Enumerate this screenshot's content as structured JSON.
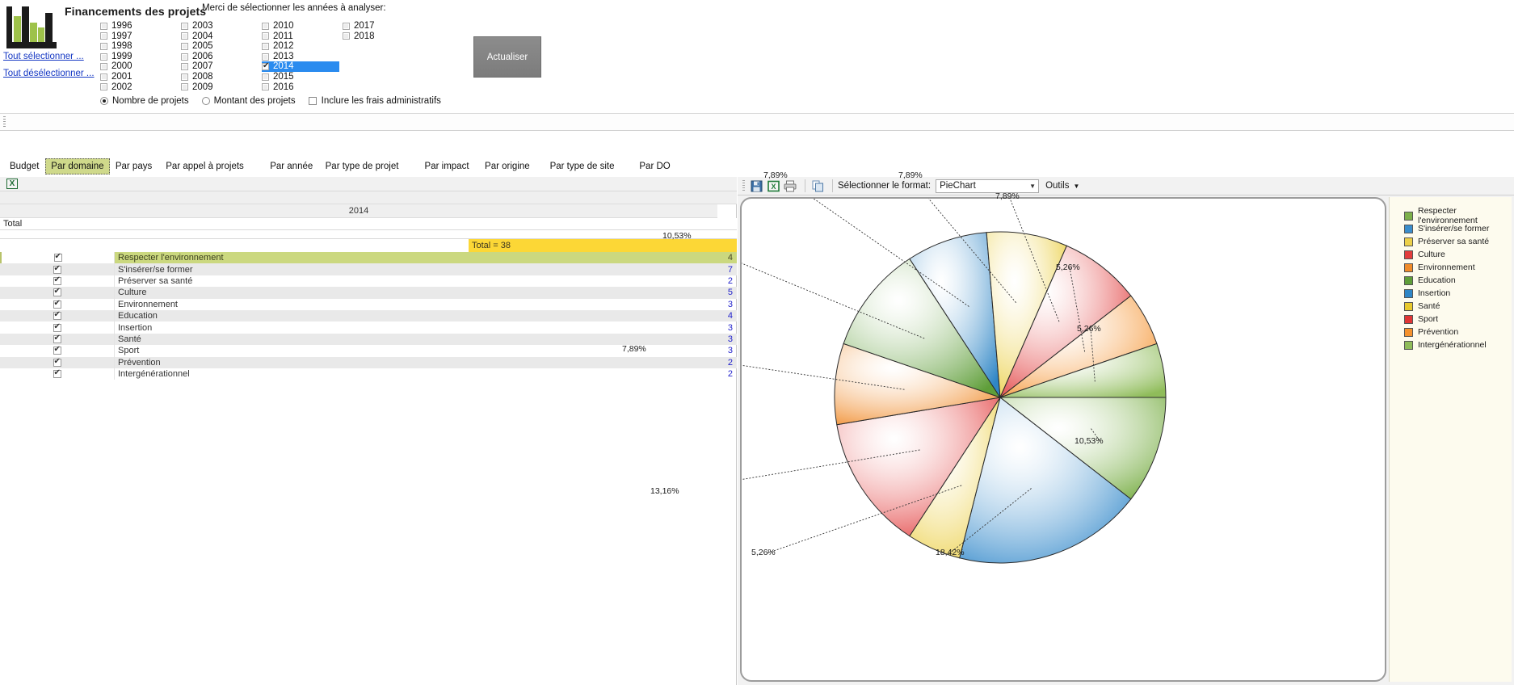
{
  "app": {
    "title": "Financements des projets",
    "logo_icon": "bar-chart-logo"
  },
  "selection_links": {
    "select_all": "Tout sélectionner ...",
    "deselect_all": "Tout désélectionner ..."
  },
  "years": {
    "instruction": "Merci de sélectionner les années à analyser:",
    "columns": [
      [
        "1996",
        "1997",
        "1998",
        "1999",
        "2000",
        "2001",
        "2002"
      ],
      [
        "2003",
        "2004",
        "2005",
        "2006",
        "2007",
        "2008",
        "2009"
      ],
      [
        "2010",
        "2011",
        "2012",
        "2013",
        "2014",
        "2015",
        "2016"
      ],
      [
        "2017",
        "2018"
      ]
    ],
    "selected": [
      "2014"
    ]
  },
  "refresh_button": "Actualiser",
  "options": {
    "radio_count": "Nombre de projets",
    "radio_amount": "Montant des projets",
    "radio_selected": "Nombre de projets",
    "checkbox_admin": "Inclure les frais administratifs",
    "checkbox_admin_checked": false
  },
  "tabs": [
    {
      "label": "Budget",
      "active": false
    },
    {
      "label": "Par domaine",
      "active": true
    },
    {
      "label": "Par pays",
      "active": false
    },
    {
      "label": "Par appel à projets",
      "active": false
    },
    {
      "label": "Par année",
      "active": false
    },
    {
      "label": "Par type de projet",
      "active": false
    },
    {
      "label": "Par impact",
      "active": false
    },
    {
      "label": "Par origine",
      "active": false
    },
    {
      "label": "Par type de site",
      "active": false
    },
    {
      "label": "Par DO",
      "active": false
    }
  ],
  "report": {
    "export_icon": "excel-export-icon",
    "year_header": "2014",
    "total_label": "Total",
    "total_value": "Total = 38",
    "rows": [
      {
        "label": "Respecter l'environnement",
        "value": "4",
        "checked": true
      },
      {
        "label": "S'insérer/se former",
        "value": "7",
        "checked": true
      },
      {
        "label": "Préserver sa santé",
        "value": "2",
        "checked": true
      },
      {
        "label": "Culture",
        "value": "5",
        "checked": true
      },
      {
        "label": "Environnement",
        "value": "3",
        "checked": true
      },
      {
        "label": "Education",
        "value": "4",
        "checked": true
      },
      {
        "label": "Insertion",
        "value": "3",
        "checked": true
      },
      {
        "label": "Santé",
        "value": "3",
        "checked": true
      },
      {
        "label": "Sport",
        "value": "3",
        "checked": true
      },
      {
        "label": "Prévention",
        "value": "2",
        "checked": true
      },
      {
        "label": "Intergénérationnel",
        "value": "2",
        "checked": true
      }
    ]
  },
  "chart_toolbar": {
    "save_icon": "save-disk-icon",
    "excel_icon": "excel-export-icon",
    "print_icon": "printer-icon",
    "copy_icon": "copy-icon",
    "format_label": "Sélectionner le format:",
    "format_value": "PieChart",
    "format_options": [
      "PieChart"
    ],
    "tools_label": "Outils",
    "caret_icon": "chevron-down-icon"
  },
  "chart_data": {
    "type": "pie",
    "title": "",
    "legend_position": "right",
    "categories": [
      "Respecter l'environnement",
      "S'insérer/se former",
      "Préserver sa santé",
      "Culture",
      "Environnement",
      "Education",
      "Insertion",
      "Santé",
      "Sport",
      "Prévention",
      "Intergénérationnel"
    ],
    "values": [
      4,
      7,
      2,
      5,
      3,
      4,
      3,
      3,
      3,
      2,
      2
    ],
    "percent_labels": [
      "10,53%",
      "18,42%",
      "5,26%",
      "13,16%",
      "7,89%",
      "10,53%",
      "7,89%",
      "7,89%",
      "7,89%",
      "5,26%",
      "5,26%"
    ],
    "colors": [
      "#7cb04a",
      "#3a8dcc",
      "#ecd04a",
      "#e23c3c",
      "#f08b2a",
      "#5f9e39",
      "#2f86c6",
      "#e8c92e",
      "#e03535",
      "#f5922e",
      "#8fbc5a"
    ],
    "total": 38
  }
}
